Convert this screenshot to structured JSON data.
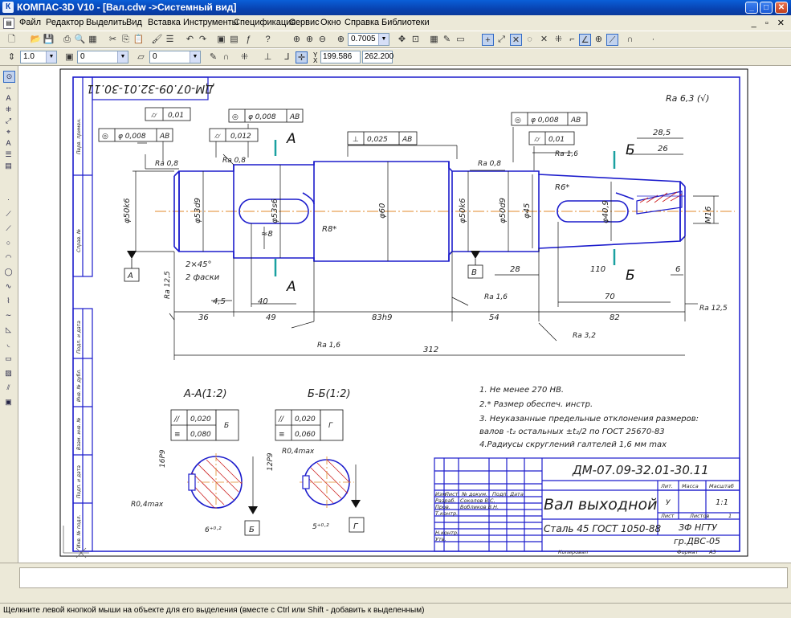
{
  "window": {
    "title": "КОМПАС-3D V10 - [Вал.cdw ->Системный вид]",
    "min": "_",
    "max": "□",
    "close": "✕"
  },
  "menu": [
    "Файл",
    "Редактор",
    "Выделить",
    "Вид",
    "Вставка",
    "Инструменты",
    "Спецификация",
    "Сервис",
    "Окно",
    "Справка",
    "Библиотеки"
  ],
  "toolbar": {
    "zoom": "0.7005"
  },
  "props": {
    "step": "1.0",
    "layer": "0",
    "style": "0",
    "x": "199.586",
    "y": "262.200"
  },
  "status": "Щелкните левой кнопкой мыши на объекте для его выделения (вместе с Ctrl или Shift - добавить к выделенным)",
  "drawing": {
    "code": "ДМ-07.09-32.01-30.11",
    "code_rot": "ДМ-07.09-32.01-30.11",
    "name": "Вал выходной",
    "material": "Сталь 45 ГОСТ 1050-88",
    "org1": "ЗФ НГТУ",
    "org2": "гр.ДВС-05",
    "mass_scale": "1:1",
    "lit": "У",
    "sheet": "Лист",
    "sheets": "Листов",
    "sheets_n": "1",
    "copied": "Копировал",
    "format": "Формат",
    "format_v": "А3",
    "roughness": "Ra 6,3 (√)",
    "stamp_headers": [
      "Лит.",
      "Масса",
      "Масштаб"
    ],
    "stamp_rows": [
      "Изм",
      "Лист",
      "№ докум.",
      "Подп.",
      "Дата"
    ],
    "stamp_roles": [
      "Разраб.",
      "Пров.",
      "Т.контр.",
      "",
      "Н.контр.",
      "Утв."
    ],
    "stamp_people": [
      "Соколов В.С.",
      "Вобликов В.Н."
    ],
    "side_labels": [
      "Перв. примен.",
      "Справ. №",
      "Подп. и дата",
      "Инв. № дубл.",
      "Взам. инв. №",
      "Подп. и дата",
      "Инв. № подл."
    ],
    "notes": [
      "1. Не менее 270 НВ.",
      "2.* Размер обеспеч. инстр.",
      "3. Неуказанные предельные отклонения размеров:",
      "    валов -t₂ остальных ±t₂/2 по ГОСТ 25670-83",
      "4.Радиусы скруглений галтелей 1,6 мм max"
    ],
    "section_aa": "А-А(1:2)",
    "section_bb": "Б-Б(1:2)",
    "dims": {
      "d50k6": "φ50k6",
      "d53d9": "φ53d9",
      "d53s6": "φ53s6",
      "d60": "φ60",
      "d50k6b": "φ50k6",
      "d50d9": "φ50d9",
      "d45": "φ45",
      "d40": "φ40,9",
      "m16": "M16",
      "chamfer": "2×45°",
      "chamfer2": "2 фаски",
      "r8": "R8*",
      "r6": "R6*",
      "w8": "≈8",
      "l4_5": "4,5",
      "l40": "40",
      "l36": "36",
      "l49": "49",
      "l83": "83h9",
      "l54": "54",
      "l82": "82",
      "l312": "312",
      "l28_5": "28,5",
      "l26": "26",
      "l28": "28",
      "l70": "70",
      "l6": "6",
      "l110": "110",
      "ra08a": "Ra 0,8",
      "ra08b": "Ra 0,8",
      "ra08c": "Ra 0,8",
      "ra16a": "Ra 1,6",
      "ra16b": "Ra 1,6",
      "ra16c": "Ra 1,6",
      "ra125a": "Ra 12,5",
      "ra125b": "Ra 12,5",
      "ra32": "Ra 3,2",
      "tol1": "0,01",
      "tol2": "φ 0,008",
      "tol2b": "АВ",
      "tol3": "0,012",
      "tol4": "φ 0,008",
      "tol4b": "АВ",
      "tol5": "0,025",
      "tol5b": "АВ",
      "tol6": "φ 0,008",
      "tol6b": "АВ",
      "tol7": "0,01",
      "base_a": "А",
      "base_b": "В",
      "base_g": "Г",
      "base_bb": "Б",
      "cutA1": "А",
      "cutA2": "А",
      "cutB1": "Б",
      "cutB2": "Б",
      "sa_16p9": "16P9",
      "sa_r04": "R0,4max",
      "sa_6": "6⁺⁰·²",
      "sa_t1": "0,020",
      "sa_t2": "0,080",
      "sa_b": "Б",
      "sb_12p9": "12P9",
      "sb_r04": "R0,4max",
      "sb_5": "5⁺⁰·²",
      "sb_t1": "0,020",
      "sb_t2": "0,060",
      "sb_g": "Г"
    }
  }
}
